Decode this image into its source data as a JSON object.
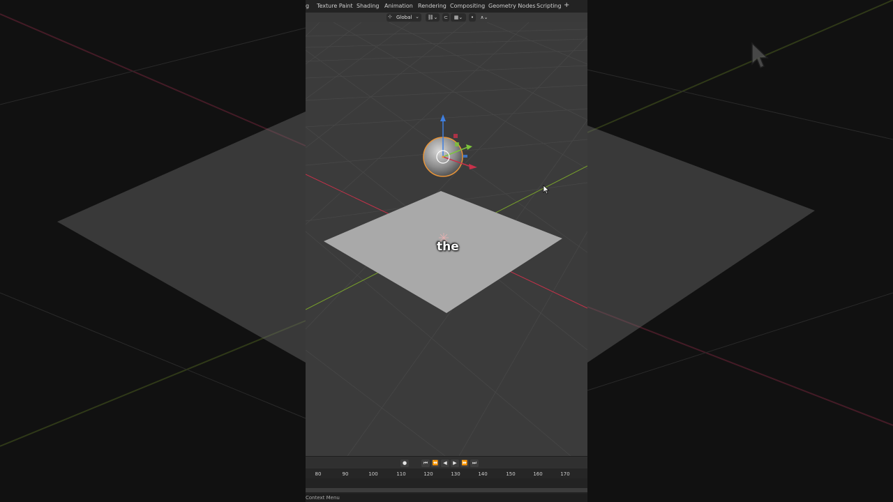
{
  "topbar": {
    "tabs": [
      "g",
      "Texture Paint",
      "Shading",
      "Animation",
      "Rendering",
      "Compositing",
      "Geometry Nodes",
      "Scripting"
    ],
    "add_label": "+"
  },
  "header": {
    "orientation": "Global",
    "orientation_icon": "transform-orientation-icon",
    "pivot_icon": "link-icon",
    "snap_icon": "magnet-icon",
    "proportional_icon": "proportional-edit-icon",
    "falloff_icon": "falloff-curve-icon"
  },
  "viewport": {
    "subtitle_word": "the",
    "selected_object_outline": "#e8953a",
    "axis_x_color": "#c8314a",
    "axis_y_color": "#7aa42a",
    "gizmo_z_color": "#3f7fe0"
  },
  "timeline": {
    "record_icon": "record-icon",
    "controls": [
      "⏮",
      "⏪",
      "◀",
      "▶",
      "⏩",
      "⏭"
    ],
    "frame_ticks": [
      "80",
      "90",
      "100",
      "110",
      "120",
      "130",
      "140",
      "150",
      "160",
      "170"
    ]
  },
  "status_bar": {
    "hint": "Context Menu"
  },
  "background": {
    "tint": "#101010"
  }
}
